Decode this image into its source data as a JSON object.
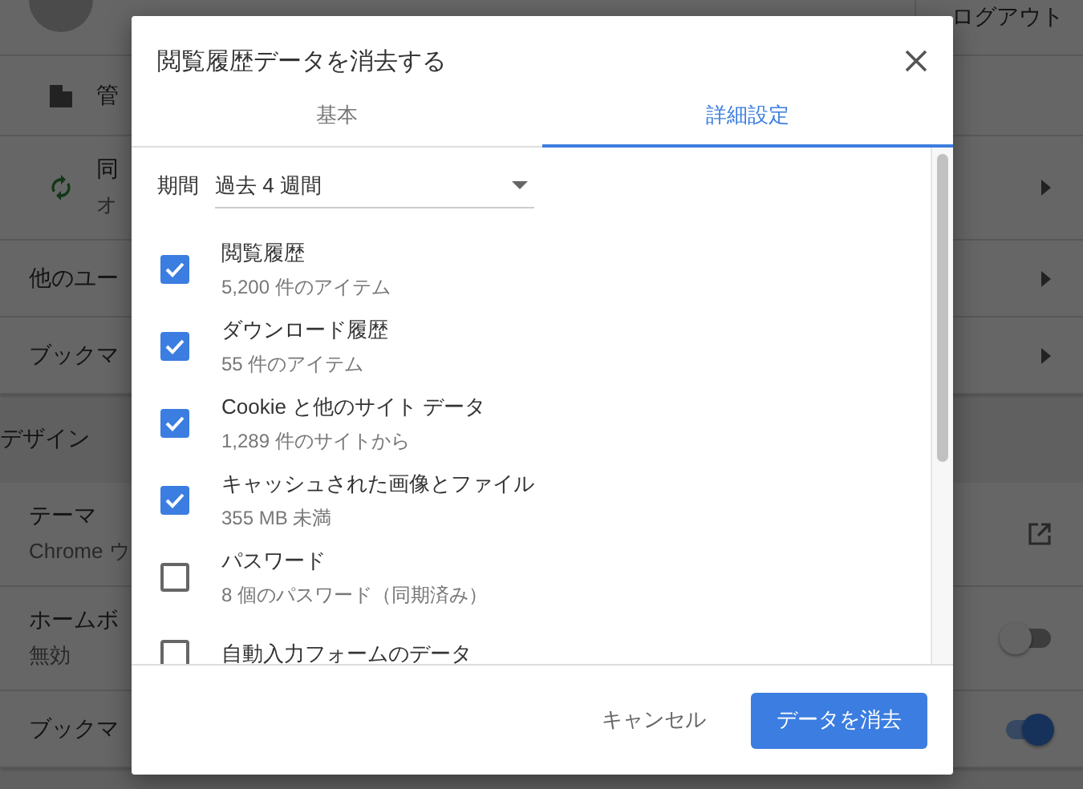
{
  "background": {
    "logout": "ログアウト",
    "rows": [
      {
        "kind": "building",
        "label": "管",
        "arrow": false
      },
      {
        "kind": "sync",
        "label": "同",
        "sub": "オ",
        "arrow": true
      },
      {
        "kind": "plain",
        "label": "他のユー",
        "arrow": true
      },
      {
        "kind": "plain",
        "label": "ブックマ",
        "arrow": true
      }
    ],
    "section": "デザイン",
    "card_rows": [
      {
        "kind": "link",
        "label": "テーマ",
        "sub": "Chrome ウ"
      },
      {
        "kind": "toggle",
        "label": "ホームボ",
        "sub": "無効",
        "on": false
      },
      {
        "kind": "toggle",
        "label": "ブックマ",
        "on": true
      }
    ]
  },
  "dialog": {
    "title": "閲覧履歴データを消去する",
    "tabs": [
      {
        "label": "基本",
        "selected": false
      },
      {
        "label": "詳細設定",
        "selected": true
      }
    ],
    "period": {
      "label": "期間",
      "value": "過去 4 週間"
    },
    "items": [
      {
        "label": "閲覧履歴",
        "detail": "5,200 件のアイテム",
        "checked": true
      },
      {
        "label": "ダウンロード履歴",
        "detail": "55 件のアイテム",
        "checked": true
      },
      {
        "label": "Cookie と他のサイト データ",
        "detail": "1,289 件のサイトから",
        "checked": true
      },
      {
        "label": "キャッシュされた画像とファイル",
        "detail": "355 MB 未満",
        "checked": true
      },
      {
        "label": "パスワード",
        "detail": "8 個のパスワード（同期済み）",
        "checked": false
      },
      {
        "label": "自動入力フォームのデータ",
        "checked": false
      }
    ],
    "buttons": {
      "cancel": "キャンセル",
      "confirm": "データを消去"
    }
  }
}
